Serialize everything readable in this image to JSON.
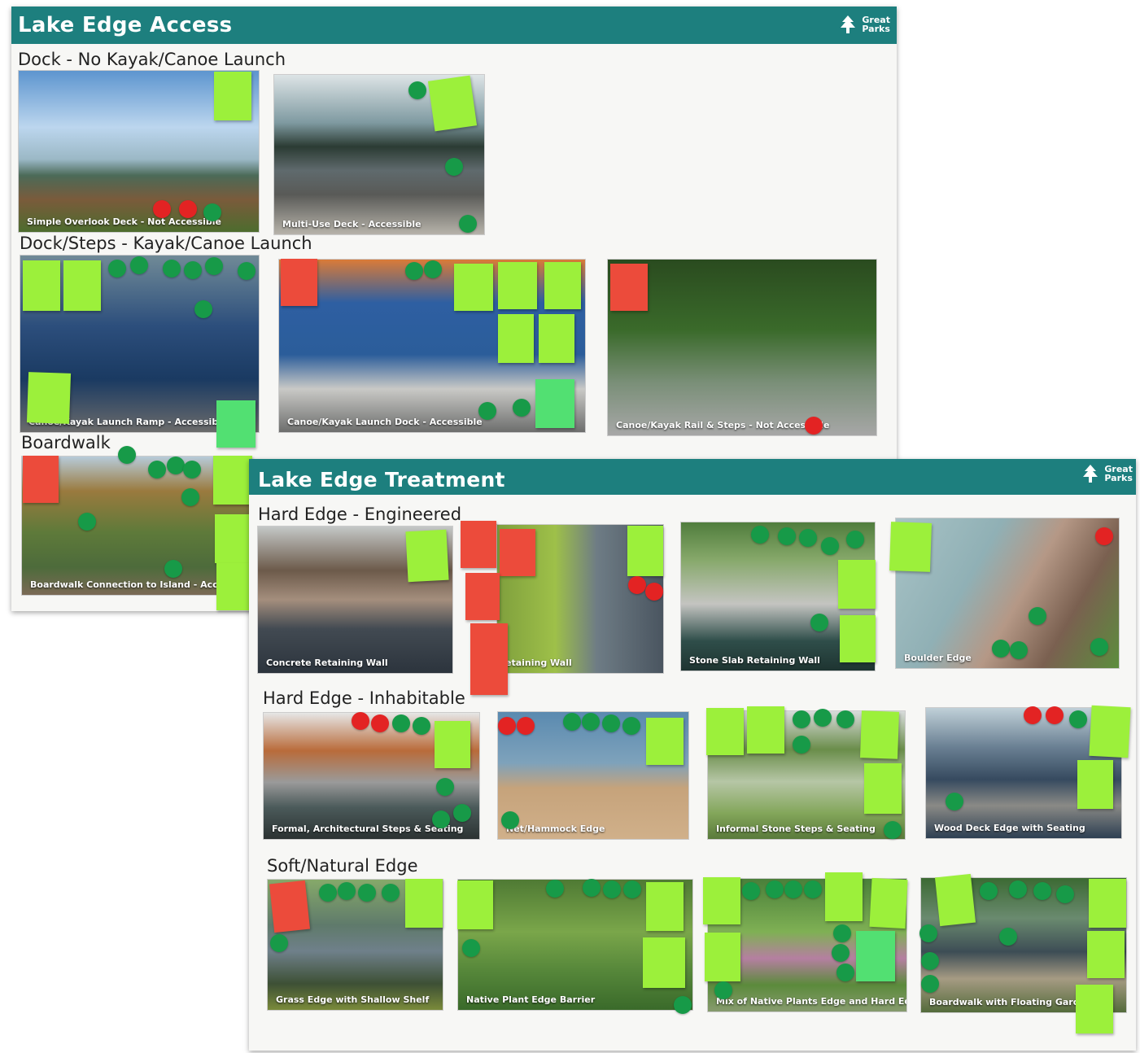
{
  "board_access": {
    "title": "Lake Edge Access",
    "brand": {
      "line1": "Great",
      "line2": "Parks"
    },
    "sections": {
      "dock_no_launch": "Dock - No Kayak/Canoe Launch",
      "dock_steps_launch": "Dock/Steps - Kayak/Canoe Launch",
      "boardwalk": "Boardwalk"
    },
    "photos": {
      "simple_overlook": "Simple Overlook Deck - Not Accessible",
      "multi_use": "Multi-Use Deck - Accessible",
      "launch_ramp": "Canoe/Kayak Launch Ramp - Accessible",
      "launch_dock": "Canoe/Kayak Launch Dock - Accessible",
      "rail_steps": "Canoe/Kayak Rail & Steps - Not Accessible",
      "boardwalk_island": "Boardwalk Connection to Island - Accessib"
    }
  },
  "board_treatment": {
    "title": "Lake Edge Treatment",
    "brand": {
      "line1": "Great",
      "line2": "Parks"
    },
    "sections": {
      "hard_engineered": "Hard Edge - Engineered",
      "hard_inhabitable": "Hard Edge - Inhabitable",
      "soft_natural": "Soft/Natural Edge"
    },
    "photos": {
      "concrete": "Concrete Retaining Wall",
      "retaining": "etaining Wall",
      "stone_slab": "Stone Slab Retaining Wall",
      "boulder": "Boulder Edge",
      "formal_steps": "Formal, Architectural Steps & Seating",
      "net_hammock": "Net/Hammock Edge",
      "informal_steps": "Informal Stone Steps & Seating",
      "wood_deck": "Wood Deck Edge with Seating",
      "grass_shelf": "Grass Edge with Shallow Shelf",
      "native_barrier": "Native Plant Edge Barrier",
      "mix_native": "Mix of Native Plants Edge and Hard Edge",
      "floating_garden": "Boardwalk with Floating Garde"
    }
  },
  "colors": {
    "header_teal": "#1d7f7e",
    "note_green": "#9cf03b",
    "note_red": "#ec4b3b",
    "dot_green": "#179a48",
    "dot_red": "#e32323"
  }
}
